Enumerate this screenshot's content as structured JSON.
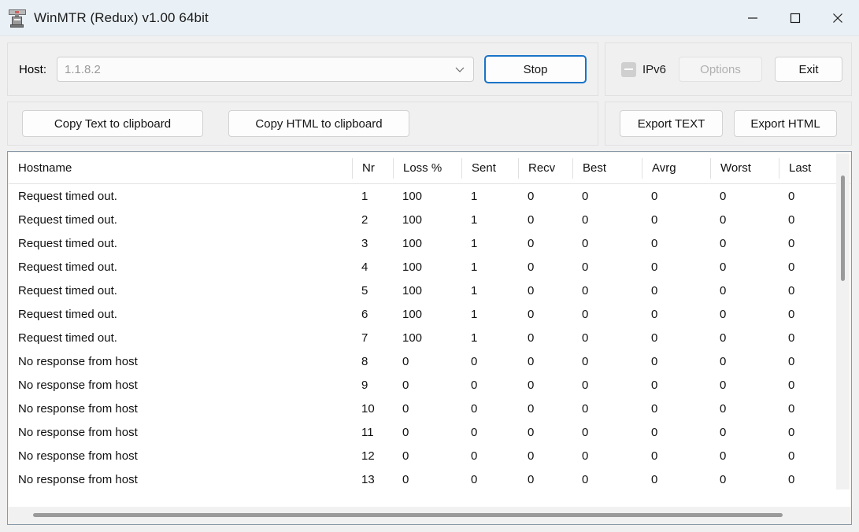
{
  "window": {
    "title": "WinMTR (Redux) v1.00 64bit",
    "icon": "winmtr-app-icon",
    "controls": {
      "minimize": "minimize-icon",
      "maximize": "maximize-icon",
      "close": "close-icon"
    }
  },
  "host_panel": {
    "label": "Host:",
    "combo_value": "1.1.8.2",
    "combo_placeholder": "1.1.8.2",
    "combo_arrow": "chevron-down-icon",
    "action_button": "Stop"
  },
  "options_panel": {
    "ipv6_label": "IPv6",
    "ipv6_state": "indeterminate-disabled",
    "options_button": "Options",
    "options_disabled": true,
    "exit_button": "Exit"
  },
  "toolbar": {
    "copy_text": "Copy Text to clipboard",
    "copy_html": "Copy HTML to clipboard",
    "export_text": "Export TEXT",
    "export_html": "Export HTML"
  },
  "table": {
    "columns": [
      "Hostname",
      "Nr",
      "Loss %",
      "Sent",
      "Recv",
      "Best",
      "Avrg",
      "Worst",
      "Last"
    ],
    "rows": [
      {
        "hostname": "Request timed out.",
        "nr": "1",
        "loss": "100",
        "sent": "1",
        "recv": "0",
        "best": "0",
        "avrg": "0",
        "worst": "0",
        "last": "0"
      },
      {
        "hostname": "Request timed out.",
        "nr": "2",
        "loss": "100",
        "sent": "1",
        "recv": "0",
        "best": "0",
        "avrg": "0",
        "worst": "0",
        "last": "0"
      },
      {
        "hostname": "Request timed out.",
        "nr": "3",
        "loss": "100",
        "sent": "1",
        "recv": "0",
        "best": "0",
        "avrg": "0",
        "worst": "0",
        "last": "0"
      },
      {
        "hostname": "Request timed out.",
        "nr": "4",
        "loss": "100",
        "sent": "1",
        "recv": "0",
        "best": "0",
        "avrg": "0",
        "worst": "0",
        "last": "0"
      },
      {
        "hostname": "Request timed out.",
        "nr": "5",
        "loss": "100",
        "sent": "1",
        "recv": "0",
        "best": "0",
        "avrg": "0",
        "worst": "0",
        "last": "0"
      },
      {
        "hostname": "Request timed out.",
        "nr": "6",
        "loss": "100",
        "sent": "1",
        "recv": "0",
        "best": "0",
        "avrg": "0",
        "worst": "0",
        "last": "0"
      },
      {
        "hostname": "Request timed out.",
        "nr": "7",
        "loss": "100",
        "sent": "1",
        "recv": "0",
        "best": "0",
        "avrg": "0",
        "worst": "0",
        "last": "0"
      },
      {
        "hostname": "No response from host",
        "nr": "8",
        "loss": "0",
        "sent": "0",
        "recv": "0",
        "best": "0",
        "avrg": "0",
        "worst": "0",
        "last": "0"
      },
      {
        "hostname": "No response from host",
        "nr": "9",
        "loss": "0",
        "sent": "0",
        "recv": "0",
        "best": "0",
        "avrg": "0",
        "worst": "0",
        "last": "0"
      },
      {
        "hostname": "No response from host",
        "nr": "10",
        "loss": "0",
        "sent": "0",
        "recv": "0",
        "best": "0",
        "avrg": "0",
        "worst": "0",
        "last": "0"
      },
      {
        "hostname": "No response from host",
        "nr": "11",
        "loss": "0",
        "sent": "0",
        "recv": "0",
        "best": "0",
        "avrg": "0",
        "worst": "0",
        "last": "0"
      },
      {
        "hostname": "No response from host",
        "nr": "12",
        "loss": "0",
        "sent": "0",
        "recv": "0",
        "best": "0",
        "avrg": "0",
        "worst": "0",
        "last": "0"
      },
      {
        "hostname": "No response from host",
        "nr": "13",
        "loss": "0",
        "sent": "0",
        "recv": "0",
        "best": "0",
        "avrg": "0",
        "worst": "0",
        "last": "0"
      }
    ]
  },
  "colors": {
    "titlebar": "#eaf1f6",
    "window_bg": "#f0f0f0",
    "accent_focus": "#1a73c8",
    "list_border": "#8a99a8",
    "disabled_text": "#b0b0b0"
  }
}
